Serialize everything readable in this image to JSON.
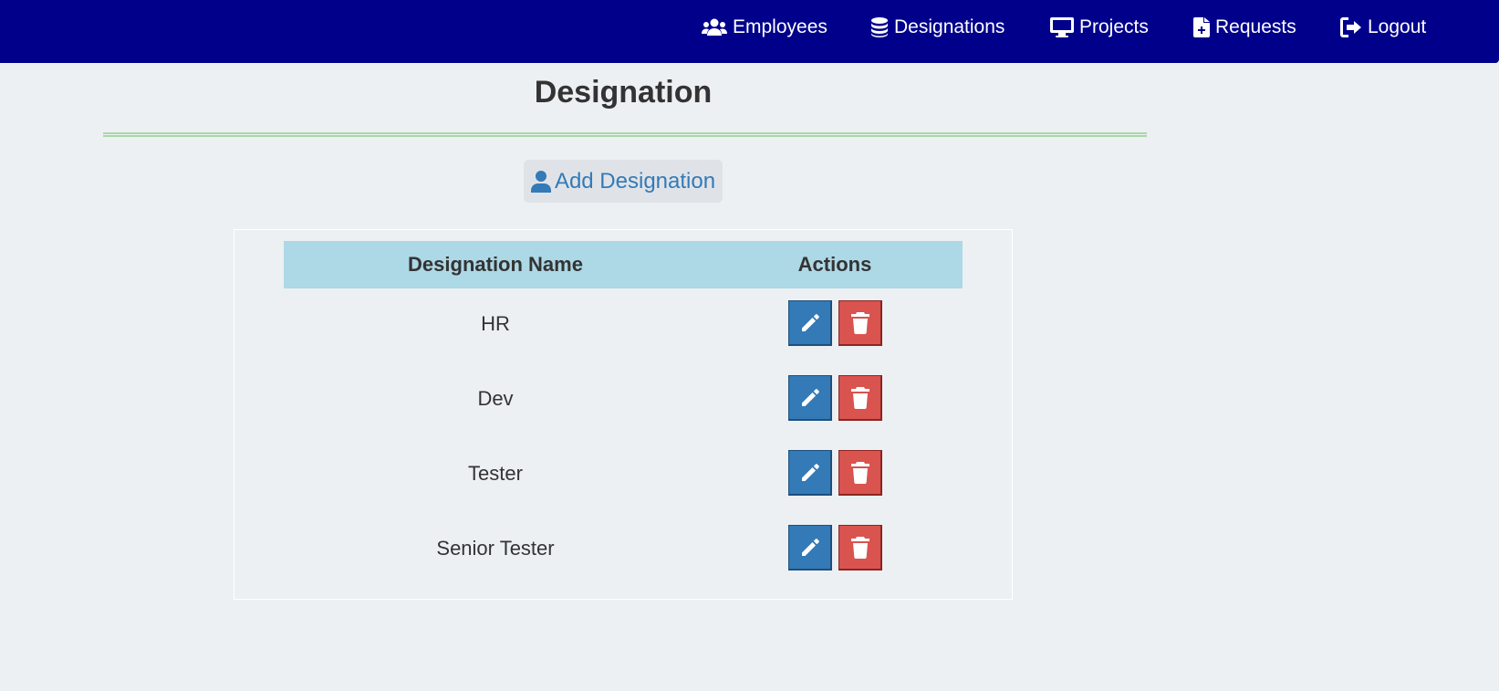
{
  "nav": {
    "employees": {
      "label": "Employees",
      "icon": "users-icon"
    },
    "designations": {
      "label": "Designations",
      "icon": "database-icon"
    },
    "projects": {
      "label": "Projects",
      "icon": "desktop-icon"
    },
    "requests": {
      "label": "Requests",
      "icon": "file-plus-icon"
    },
    "logout": {
      "label": "Logout",
      "icon": "logout-icon"
    }
  },
  "page": {
    "title": "Designation",
    "add_button_label": "Add Designation"
  },
  "table": {
    "columns": [
      "Designation Name",
      "Actions"
    ],
    "rows": [
      {
        "name": "HR"
      },
      {
        "name": "Dev"
      },
      {
        "name": "Tester"
      },
      {
        "name": "Senior Tester"
      }
    ]
  },
  "colors": {
    "navbar": "#00008b",
    "background": "#edf0f3",
    "table_header": "#add8e6",
    "edit_button": "#337ab7",
    "delete_button": "#d9534f",
    "link": "#337ab7"
  }
}
